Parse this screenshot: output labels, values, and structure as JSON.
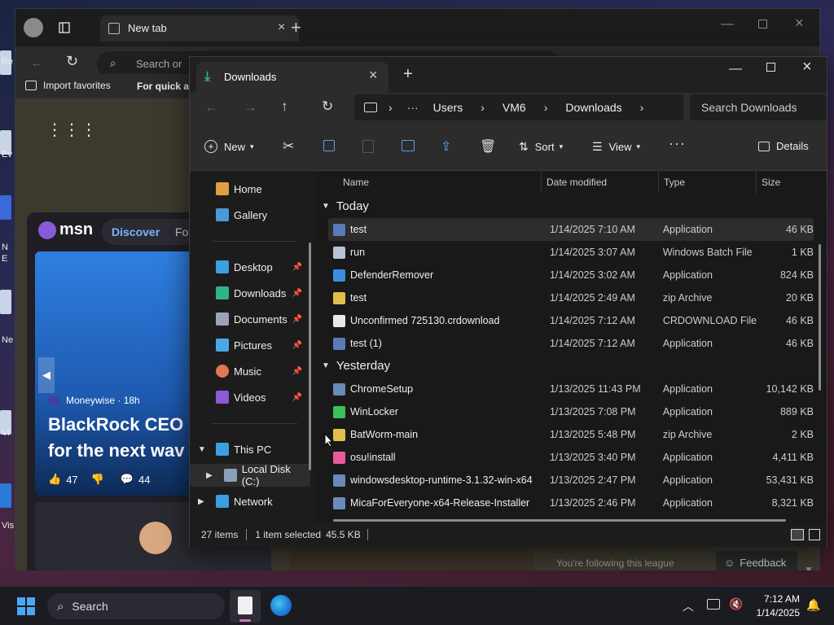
{
  "desktop": {
    "labels": [
      "Re",
      "Ev",
      "N",
      "E",
      "Ne",
      "Vi",
      "Vis"
    ]
  },
  "edge": {
    "tab_title": "New tab",
    "address_placeholder": "Search or",
    "favorites": [
      "Import favorites",
      "For quick ac"
    ],
    "msn": {
      "brand": "msn",
      "tabs": [
        "Discover",
        "Fol"
      ],
      "source": "Moneywise · 18h",
      "headline_1": "BlackRock CEO I",
      "headline_2": "for the next wav",
      "likes": "47",
      "comments": "44",
      "following": "You're following this league",
      "feedback": "Feedback"
    }
  },
  "explorer": {
    "tab_title": "Downloads",
    "breadcrumb": [
      "Users",
      "VM6",
      "Downloads"
    ],
    "search_placeholder": "Search Downloads",
    "toolbar": {
      "new": "New",
      "sort": "Sort",
      "view": "View",
      "details": "Details"
    },
    "nav": [
      {
        "label": "Home",
        "color": "#e0a040"
      },
      {
        "label": "Gallery",
        "color": "#4a9ad8"
      },
      {
        "label": "Desktop",
        "color": "#3aa0e0",
        "pinned": true
      },
      {
        "label": "Downloads",
        "color": "#2fb38a",
        "pinned": true
      },
      {
        "label": "Documents",
        "color": "#9aa4b4",
        "pinned": true
      },
      {
        "label": "Pictures",
        "color": "#4aa8e8",
        "pinned": true
      },
      {
        "label": "Music",
        "color": "#e07850",
        "pinned": true
      },
      {
        "label": "Videos",
        "color": "#8a5ad8",
        "pinned": true
      },
      {
        "label": "This PC",
        "color": "#3aa0e0"
      },
      {
        "label": "Local Disk (C:)",
        "color": "#8aa0b8"
      },
      {
        "label": "Network",
        "color": "#3aa0e0"
      }
    ],
    "columns": [
      "Name",
      "Date modified",
      "Type",
      "Size"
    ],
    "groups": [
      {
        "label": "Today",
        "files": [
          {
            "name": "test",
            "date": "1/14/2025 7:10 AM",
            "type": "Application",
            "size": "46 KB",
            "icon_color": "#5a7ab8",
            "selected": true
          },
          {
            "name": "run",
            "date": "1/14/2025 3:07 AM",
            "type": "Windows Batch File",
            "size": "1 KB",
            "icon_color": "#b8c4d4"
          },
          {
            "name": "DefenderRemover",
            "date": "1/14/2025 3:02 AM",
            "type": "Application",
            "size": "824 KB",
            "icon_color": "#3a8ee0"
          },
          {
            "name": "test",
            "date": "1/14/2025 2:49 AM",
            "type": "zip Archive",
            "size": "20 KB",
            "icon_color": "#e0c04a"
          },
          {
            "name": "Unconfirmed 725130.crdownload",
            "date": "1/14/2025 7:12 AM",
            "type": "CRDOWNLOAD File",
            "size": "46 KB",
            "icon_color": "#e8e8e8"
          },
          {
            "name": "test (1)",
            "date": "1/14/2025 7:12 AM",
            "type": "Application",
            "size": "46 KB",
            "icon_color": "#5a7ab8"
          }
        ]
      },
      {
        "label": "Yesterday",
        "files": [
          {
            "name": "ChromeSetup",
            "date": "1/13/2025 11:43 PM",
            "type": "Application",
            "size": "10,142 KB",
            "icon_color": "#6a8ab8"
          },
          {
            "name": "WinLocker",
            "date": "1/13/2025 7:08 PM",
            "type": "Application",
            "size": "889 KB",
            "icon_color": "#3ac05a"
          },
          {
            "name": "BatWorm-main",
            "date": "1/13/2025 5:48 PM",
            "type": "zip Archive",
            "size": "2 KB",
            "icon_color": "#e0c04a"
          },
          {
            "name": "osu!install",
            "date": "1/13/2025 3:40 PM",
            "type": "Application",
            "size": "4,411 KB",
            "icon_color": "#e85a9a"
          },
          {
            "name": "windowsdesktop-runtime-3.1.32-win-x64",
            "date": "1/13/2025 2:47 PM",
            "type": "Application",
            "size": "53,431 KB",
            "icon_color": "#6a8ab8"
          },
          {
            "name": "MicaForEveryone-x64-Release-Installer",
            "date": "1/13/2025 2:46 PM",
            "type": "Application",
            "size": "8,321 KB",
            "icon_color": "#6a8ab8"
          }
        ]
      }
    ],
    "status": {
      "count": "27 items",
      "selection": "1 item selected",
      "size": "45.5 KB"
    }
  },
  "taskbar": {
    "search": "Search",
    "time": "7:12 AM",
    "date": "1/14/2025"
  }
}
